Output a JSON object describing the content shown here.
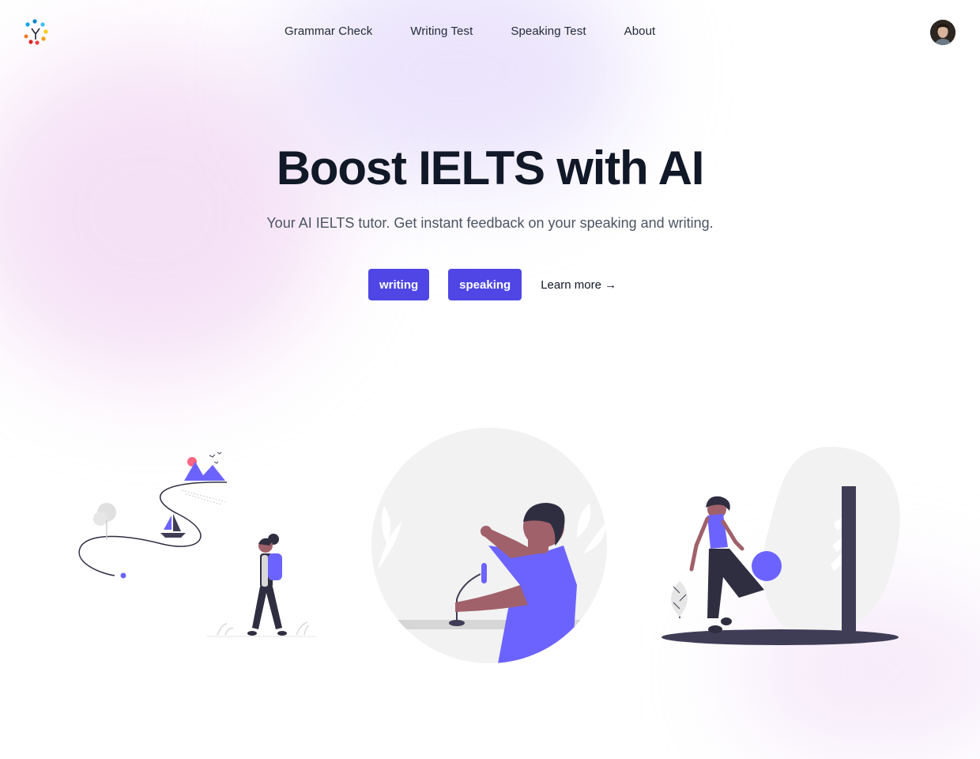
{
  "nav": {
    "items": [
      {
        "label": "Grammar Check"
      },
      {
        "label": "Writing Test"
      },
      {
        "label": "Speaking Test"
      },
      {
        "label": "About"
      }
    ]
  },
  "hero": {
    "title": "Boost IELTS with AI",
    "subtitle": "Your AI IELTS tutor. Get instant feedback on your speaking and writing.",
    "writing_button": "writing",
    "speaking_button": "speaking",
    "learn_more": "Learn more →"
  },
  "colors": {
    "accent": "#4f46e5",
    "illustration_accent": "#6c63ff",
    "dark": "#3f3d56",
    "skin": "#a0616a"
  },
  "icons": {
    "logo": "dotted-y-logo-icon",
    "avatar": "user-avatar"
  }
}
